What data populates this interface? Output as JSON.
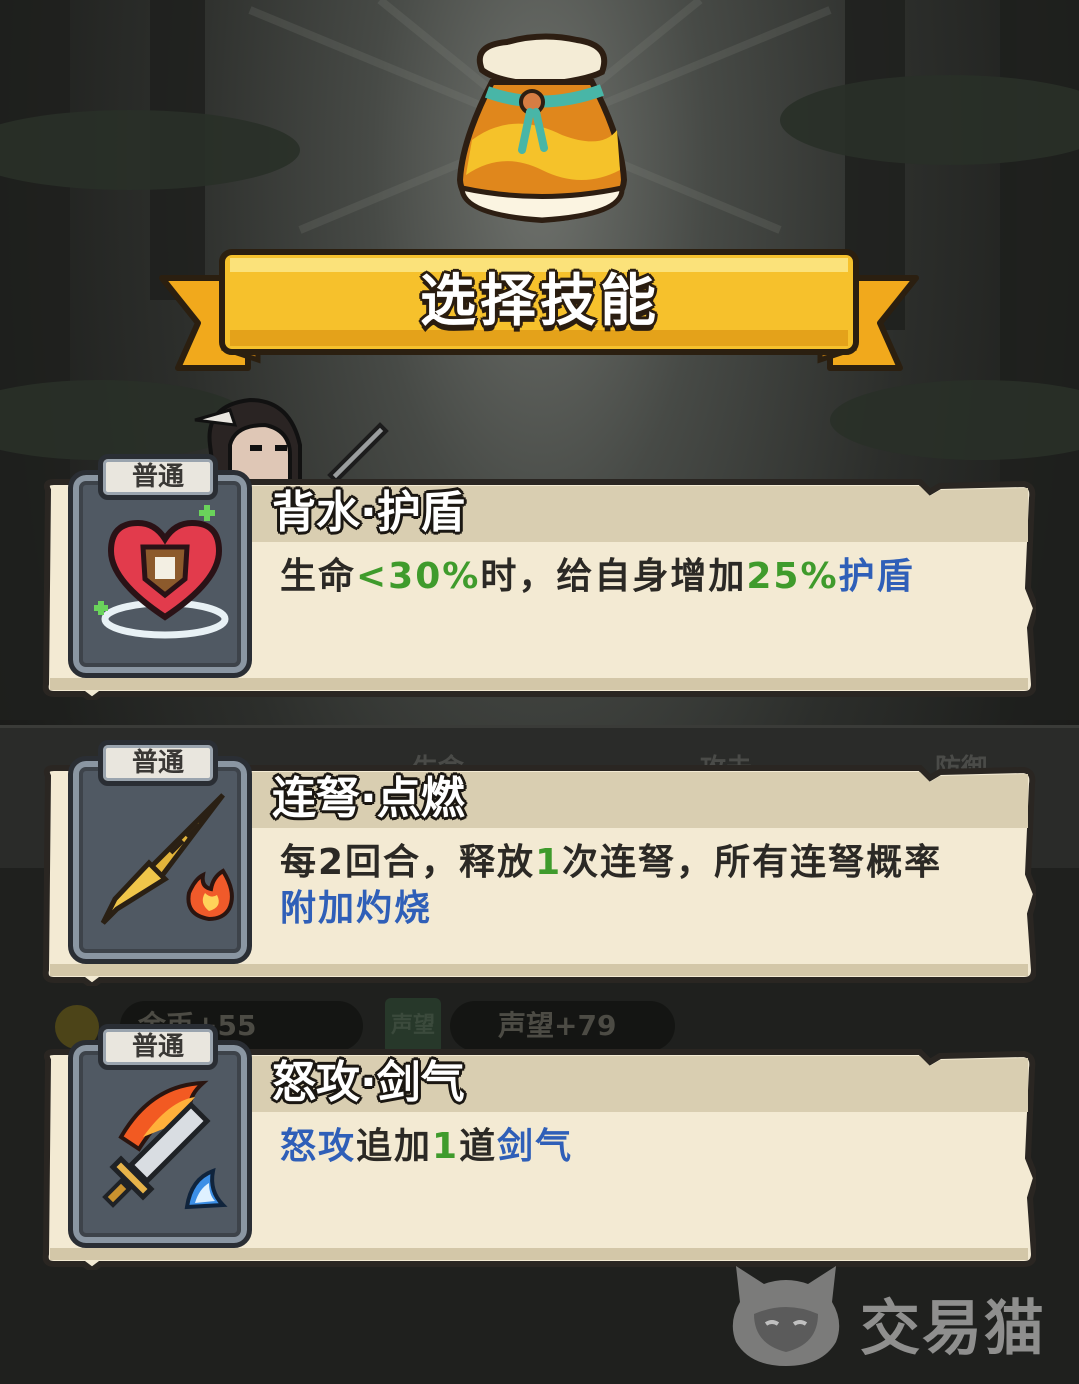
{
  "screen": {
    "title": "选择技能"
  },
  "background_hud": {
    "stat_labels": [
      "生命",
      "攻击",
      "防御"
    ],
    "reward_gold": "金币+55",
    "reward_fame_badge": "声望",
    "reward_fame": "声望+79"
  },
  "skills": [
    {
      "rarity": "普通",
      "name": "背水·护盾",
      "icon": "heart-shield-icon",
      "desc": [
        {
          "t": "生命",
          "c": "normal"
        },
        {
          "t": "<30%",
          "c": "green"
        },
        {
          "t": "时，给自身增加",
          "c": "normal"
        },
        {
          "t": "25%",
          "c": "green"
        },
        {
          "t": "护盾",
          "c": "blue"
        }
      ]
    },
    {
      "rarity": "普通",
      "name": "连弩·点燃",
      "icon": "flaming-bolt-icon",
      "desc": [
        {
          "t": "每2回合，释放",
          "c": "normal"
        },
        {
          "t": "1",
          "c": "green"
        },
        {
          "t": "次连弩，所有连弩概率",
          "c": "normal"
        },
        {
          "t": "附加灼烧",
          "c": "blue"
        }
      ]
    },
    {
      "rarity": "普通",
      "name": "怒攻·剑气",
      "icon": "flaming-sword-icon",
      "desc": [
        {
          "t": "怒攻",
          "c": "blue"
        },
        {
          "t": "追加",
          "c": "normal"
        },
        {
          "t": "1",
          "c": "green"
        },
        {
          "t": "道",
          "c": "normal"
        },
        {
          "t": "剑气",
          "c": "blue"
        }
      ]
    }
  ],
  "watermark": {
    "text": "交易猫"
  },
  "colors": {
    "highlight_green": "#3f9b2c",
    "highlight_blue": "#2f5fb8",
    "card_parchment": "#f3ead3",
    "card_header": "#d9ceb1",
    "banner_gold": "#f6c12c"
  }
}
